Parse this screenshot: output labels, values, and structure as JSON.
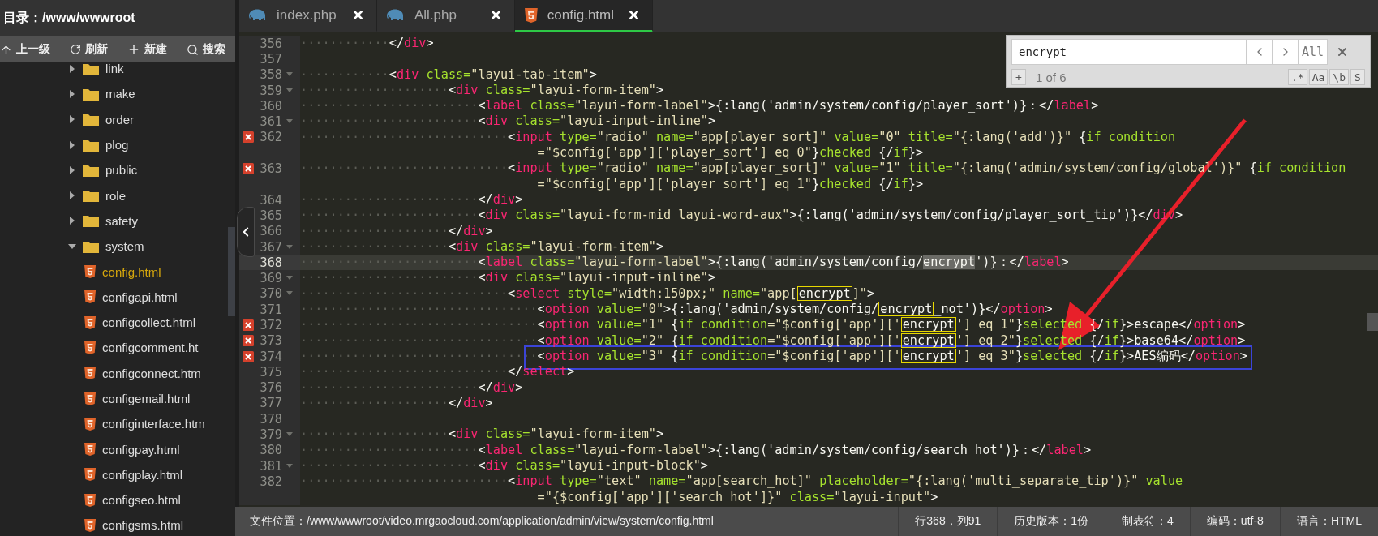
{
  "sidebar": {
    "title": "目录：/www/wwwroot",
    "toolbar": [
      {
        "kind": "up",
        "label": "上一级"
      },
      {
        "kind": "refresh",
        "label": "刷新"
      },
      {
        "kind": "new",
        "label": "新建"
      },
      {
        "kind": "search",
        "label": "搜索"
      }
    ],
    "tree": [
      {
        "label": "link",
        "kind": "folder",
        "expanded": false,
        "selected": false
      },
      {
        "label": "make",
        "kind": "folder",
        "expanded": false,
        "selected": false
      },
      {
        "label": "order",
        "kind": "folder",
        "expanded": false,
        "selected": false
      },
      {
        "label": "plog",
        "kind": "folder",
        "expanded": false,
        "selected": false
      },
      {
        "label": "public",
        "kind": "folder",
        "expanded": false,
        "selected": false
      },
      {
        "label": "role",
        "kind": "folder",
        "expanded": false,
        "selected": false
      },
      {
        "label": "safety",
        "kind": "folder",
        "expanded": false,
        "selected": false
      },
      {
        "label": "system",
        "kind": "folder",
        "expanded": true,
        "selected": false,
        "children": [
          {
            "label": "config.html",
            "kind": "html",
            "selected": true
          },
          {
            "label": "configapi.html",
            "kind": "html",
            "selected": false
          },
          {
            "label": "configcollect.html",
            "kind": "html",
            "selected": false
          },
          {
            "label": "configcomment.ht",
            "kind": "html",
            "selected": false
          },
          {
            "label": "configconnect.htm",
            "kind": "html",
            "selected": false
          },
          {
            "label": "configemail.html",
            "kind": "html",
            "selected": false
          },
          {
            "label": "configinterface.htm",
            "kind": "html",
            "selected": false
          },
          {
            "label": "configpay.html",
            "kind": "html",
            "selected": false
          },
          {
            "label": "configplay.html",
            "kind": "html",
            "selected": false
          },
          {
            "label": "configseo.html",
            "kind": "html",
            "selected": false
          },
          {
            "label": "configsms.html",
            "kind": "html",
            "selected": false
          }
        ]
      }
    ]
  },
  "tabs": [
    {
      "label": "index.php",
      "kind": "php",
      "selected": false
    },
    {
      "label": "All.php",
      "kind": "php",
      "selected": false
    },
    {
      "label": "config.html",
      "kind": "html",
      "selected": true
    }
  ],
  "find": {
    "query": "encrypt",
    "all_label": "All",
    "add_label": "+",
    "count": "1 of 6",
    "options": [
      ".*",
      "Aa",
      "\\b",
      "S"
    ]
  },
  "lines": [
    {
      "n": "356",
      "fold": false,
      "error": false,
      "current": false,
      "boxed": false,
      "tokens": [
        {
          "kind": "ws",
          "text": "············"
        },
        {
          "kind": "plain",
          "text": "</"
        },
        {
          "kind": "tag",
          "text": "div"
        },
        {
          "kind": "plain",
          "text": ">"
        }
      ]
    },
    {
      "n": "357",
      "fold": false,
      "error": false,
      "current": false,
      "boxed": false
    },
    {
      "n": "358",
      "fold": true,
      "error": false,
      "current": false,
      "boxed": false,
      "tokens": [
        {
          "kind": "ws",
          "text": "············"
        },
        {
          "kind": "plain",
          "text": "<"
        },
        {
          "kind": "tag",
          "text": "div"
        },
        {
          "kind": "attr",
          "text": " class="
        },
        {
          "kind": "string",
          "text": "\"layui-tab-item\""
        },
        {
          "kind": "plain",
          "text": ">"
        }
      ]
    },
    {
      "n": "359",
      "fold": true,
      "error": false,
      "current": false,
      "boxed": false,
      "tokens": [
        {
          "kind": "ws",
          "text": "····················"
        },
        {
          "kind": "plain",
          "text": "<"
        },
        {
          "kind": "tag",
          "text": "div"
        },
        {
          "kind": "attr",
          "text": " class="
        },
        {
          "kind": "string",
          "text": "\"layui-form-item\""
        },
        {
          "kind": "plain",
          "text": ">"
        }
      ]
    },
    {
      "n": "360",
      "fold": false,
      "error": false,
      "current": false,
      "boxed": false,
      "tokens": [
        {
          "kind": "ws",
          "text": "························"
        },
        {
          "kind": "plain",
          "text": "<"
        },
        {
          "kind": "tag",
          "text": "label"
        },
        {
          "kind": "attr",
          "text": " class="
        },
        {
          "kind": "string",
          "text": "\"layui-form-label\""
        },
        {
          "kind": "plain",
          "text": ">{:lang('admin/system/config/player_sort')}：</"
        },
        {
          "kind": "tag",
          "text": "label"
        },
        {
          "kind": "plain",
          "text": ">"
        }
      ]
    },
    {
      "n": "361",
      "fold": true,
      "error": false,
      "current": false,
      "boxed": false,
      "tokens": [
        {
          "kind": "ws",
          "text": "························"
        },
        {
          "kind": "plain",
          "text": "<"
        },
        {
          "kind": "tag",
          "text": "div"
        },
        {
          "kind": "attr",
          "text": " class="
        },
        {
          "kind": "string",
          "text": "\"layui-input-inline\""
        },
        {
          "kind": "plain",
          "text": ">"
        }
      ]
    },
    {
      "n": "362",
      "fold": false,
      "error": true,
      "current": false,
      "boxed": false,
      "tokens": [
        {
          "kind": "ws",
          "text": "····························"
        },
        {
          "kind": "plain",
          "text": "<"
        },
        {
          "kind": "tag",
          "text": "input"
        },
        {
          "kind": "attr",
          "text": " type="
        },
        {
          "kind": "string",
          "text": "\"radio\""
        },
        {
          "kind": "attr",
          "text": " name="
        },
        {
          "kind": "string",
          "text": "\"app[player_sort]\""
        },
        {
          "kind": "attr",
          "text": " value="
        },
        {
          "kind": "string",
          "text": "\"0\""
        },
        {
          "kind": "attr",
          "text": " title="
        },
        {
          "kind": "string",
          "text": "\"{:lang('add')}\""
        },
        {
          "kind": "plain",
          "text": " {"
        },
        {
          "kind": "attr",
          "text": "if condition"
        }
      ],
      "wrap_tokens": [
        {
          "kind": "string",
          "text": "=\"$config['app']['player_sort'] eq 0\""
        },
        {
          "kind": "plain",
          "text": "}"
        },
        {
          "kind": "attr",
          "text": "checked"
        },
        {
          "kind": "plain",
          "text": " {/"
        },
        {
          "kind": "attr",
          "text": "if"
        },
        {
          "kind": "plain",
          "text": "}>"
        }
      ]
    },
    {
      "n": "363",
      "fold": false,
      "error": true,
      "current": false,
      "boxed": false,
      "tokens": [
        {
          "kind": "ws",
          "text": "····························"
        },
        {
          "kind": "plain",
          "text": "<"
        },
        {
          "kind": "tag",
          "text": "input"
        },
        {
          "kind": "attr",
          "text": " type="
        },
        {
          "kind": "string",
          "text": "\"radio\""
        },
        {
          "kind": "attr",
          "text": " name="
        },
        {
          "kind": "string",
          "text": "\"app[player_sort]\""
        },
        {
          "kind": "attr",
          "text": " value="
        },
        {
          "kind": "string",
          "text": "\"1\""
        },
        {
          "kind": "attr",
          "text": " title="
        },
        {
          "kind": "string",
          "text": "\"{:lang('admin/system/config/global')}\""
        },
        {
          "kind": "plain",
          "text": " {"
        },
        {
          "kind": "attr",
          "text": "if condition"
        }
      ],
      "wrap_tokens": [
        {
          "kind": "string",
          "text": "=\"$config['app']['player_sort'] eq 1\""
        },
        {
          "kind": "plain",
          "text": "}"
        },
        {
          "kind": "attr",
          "text": "checked"
        },
        {
          "kind": "plain",
          "text": " {/"
        },
        {
          "kind": "attr",
          "text": "if"
        },
        {
          "kind": "plain",
          "text": "}>"
        }
      ]
    },
    {
      "n": "364",
      "fold": false,
      "error": false,
      "current": false,
      "boxed": false,
      "tokens": [
        {
          "kind": "ws",
          "text": "························"
        },
        {
          "kind": "plain",
          "text": "</"
        },
        {
          "kind": "tag",
          "text": "div"
        },
        {
          "kind": "plain",
          "text": ">"
        }
      ]
    },
    {
      "n": "365",
      "fold": false,
      "error": false,
      "current": false,
      "boxed": false,
      "tokens": [
        {
          "kind": "ws",
          "text": "························"
        },
        {
          "kind": "plain",
          "text": "<"
        },
        {
          "kind": "tag",
          "text": "div"
        },
        {
          "kind": "attr",
          "text": " class="
        },
        {
          "kind": "string",
          "text": "\"layui-form-mid layui-word-aux\""
        },
        {
          "kind": "plain",
          "text": ">{:lang('admin/system/config/player_sort_tip')}</"
        },
        {
          "kind": "tag",
          "text": "div"
        },
        {
          "kind": "plain",
          "text": ">"
        }
      ]
    },
    {
      "n": "366",
      "fold": false,
      "error": false,
      "current": false,
      "boxed": false,
      "tokens": [
        {
          "kind": "ws",
          "text": "····················"
        },
        {
          "kind": "plain",
          "text": "</"
        },
        {
          "kind": "tag",
          "text": "div"
        },
        {
          "kind": "plain",
          "text": ">"
        }
      ]
    },
    {
      "n": "367",
      "fold": true,
      "error": false,
      "current": false,
      "boxed": false,
      "tokens": [
        {
          "kind": "ws",
          "text": "····················"
        },
        {
          "kind": "plain",
          "text": "<"
        },
        {
          "kind": "tag",
          "text": "div"
        },
        {
          "kind": "attr",
          "text": " class="
        },
        {
          "kind": "string",
          "text": "\"layui-form-item\""
        },
        {
          "kind": "plain",
          "text": ">"
        }
      ]
    },
    {
      "n": "368",
      "fold": false,
      "error": false,
      "current": true,
      "boxed": false,
      "tokens": [
        {
          "kind": "ws",
          "text": "························"
        },
        {
          "kind": "plain",
          "text": "<"
        },
        {
          "kind": "tag",
          "text": "label"
        },
        {
          "kind": "attr",
          "text": " class="
        },
        {
          "kind": "string",
          "text": "\"layui-form-label\""
        },
        {
          "kind": "plain",
          "text": ">{:lang('admin/system/config/"
        },
        {
          "kind": "current",
          "text": "encrypt"
        },
        {
          "kind": "plain",
          "text": "')}：</"
        },
        {
          "kind": "tag",
          "text": "label"
        },
        {
          "kind": "plain",
          "text": ">"
        }
      ]
    },
    {
      "n": "369",
      "fold": true,
      "error": false,
      "current": false,
      "boxed": false,
      "tokens": [
        {
          "kind": "ws",
          "text": "························"
        },
        {
          "kind": "plain",
          "text": "<"
        },
        {
          "kind": "tag",
          "text": "div"
        },
        {
          "kind": "attr",
          "text": " class="
        },
        {
          "kind": "string",
          "text": "\"layui-input-inline\""
        },
        {
          "kind": "plain",
          "text": ">"
        }
      ]
    },
    {
      "n": "370",
      "fold": true,
      "error": false,
      "current": false,
      "boxed": false,
      "tokens": [
        {
          "kind": "ws",
          "text": "····························"
        },
        {
          "kind": "plain",
          "text": "<"
        },
        {
          "kind": "tag",
          "text": "select"
        },
        {
          "kind": "attr",
          "text": " style="
        },
        {
          "kind": "string",
          "text": "\"width:150px;\""
        },
        {
          "kind": "attr",
          "text": " name="
        },
        {
          "kind": "string",
          "text": "\"app["
        },
        {
          "kind": "match",
          "text": "encrypt"
        },
        {
          "kind": "string",
          "text": "]\""
        },
        {
          "kind": "plain",
          "text": ">"
        }
      ]
    },
    {
      "n": "371",
      "fold": false,
      "error": false,
      "current": false,
      "boxed": false,
      "tokens": [
        {
          "kind": "ws",
          "text": "································"
        },
        {
          "kind": "plain",
          "text": "<"
        },
        {
          "kind": "tag",
          "text": "option"
        },
        {
          "kind": "attr",
          "text": " value="
        },
        {
          "kind": "string",
          "text": "\"0\""
        },
        {
          "kind": "plain",
          "text": ">{:lang('admin/system/config/"
        },
        {
          "kind": "match",
          "text": "encrypt"
        },
        {
          "kind": "plain",
          "text": "_not')}</"
        },
        {
          "kind": "tag",
          "text": "option"
        },
        {
          "kind": "plain",
          "text": ">"
        }
      ]
    },
    {
      "n": "372",
      "fold": false,
      "error": true,
      "current": false,
      "boxed": false,
      "tokens": [
        {
          "kind": "ws",
          "text": "································"
        },
        {
          "kind": "plain",
          "text": "<"
        },
        {
          "kind": "tag",
          "text": "option"
        },
        {
          "kind": "attr",
          "text": " value="
        },
        {
          "kind": "string",
          "text": "\"1\""
        },
        {
          "kind": "plain",
          "text": " {"
        },
        {
          "kind": "attr",
          "text": "if condition"
        },
        {
          "kind": "string",
          "text": "=\"$config['app']['"
        },
        {
          "kind": "match",
          "text": "encrypt"
        },
        {
          "kind": "string",
          "text": "'] eq 1\""
        },
        {
          "kind": "plain",
          "text": "}"
        },
        {
          "kind": "attr",
          "text": "selected"
        },
        {
          "kind": "plain",
          "text": " {/"
        },
        {
          "kind": "attr",
          "text": "if"
        },
        {
          "kind": "plain",
          "text": "}>escape</"
        },
        {
          "kind": "tag",
          "text": "option"
        },
        {
          "kind": "plain",
          "text": ">"
        }
      ]
    },
    {
      "n": "373",
      "fold": false,
      "error": true,
      "current": false,
      "boxed": false,
      "tokens": [
        {
          "kind": "ws",
          "text": "································"
        },
        {
          "kind": "plain",
          "text": "<"
        },
        {
          "kind": "tag",
          "text": "option"
        },
        {
          "kind": "attr",
          "text": " value="
        },
        {
          "kind": "string",
          "text": "\"2\""
        },
        {
          "kind": "plain",
          "text": " {"
        },
        {
          "kind": "attr",
          "text": "if condition"
        },
        {
          "kind": "string",
          "text": "=\"$config['app']['"
        },
        {
          "kind": "match",
          "text": "encrypt"
        },
        {
          "kind": "string",
          "text": "'] eq 2\""
        },
        {
          "kind": "plain",
          "text": "}"
        },
        {
          "kind": "attr",
          "text": "selected"
        },
        {
          "kind": "plain",
          "text": " {/"
        },
        {
          "kind": "attr",
          "text": "if"
        },
        {
          "kind": "plain",
          "text": "}>base64</"
        },
        {
          "kind": "tag",
          "text": "option"
        },
        {
          "kind": "plain",
          "text": ">"
        }
      ]
    },
    {
      "n": "374",
      "fold": false,
      "error": true,
      "current": false,
      "boxed": true,
      "tokens": [
        {
          "kind": "ws",
          "text": "································"
        },
        {
          "kind": "plain",
          "text": "<"
        },
        {
          "kind": "tag",
          "text": "option"
        },
        {
          "kind": "attr",
          "text": " value="
        },
        {
          "kind": "string",
          "text": "\"3\""
        },
        {
          "kind": "plain",
          "text": " {"
        },
        {
          "kind": "attr",
          "text": "if condition"
        },
        {
          "kind": "string",
          "text": "=\"$config['app']['"
        },
        {
          "kind": "match",
          "text": "encrypt"
        },
        {
          "kind": "string",
          "text": "'] eq 3\""
        },
        {
          "kind": "plain",
          "text": "}"
        },
        {
          "kind": "attr",
          "text": "selected"
        },
        {
          "kind": "plain",
          "text": " {/"
        },
        {
          "kind": "attr",
          "text": "if"
        },
        {
          "kind": "plain",
          "text": "}>AES编码</"
        },
        {
          "kind": "tag",
          "text": "option"
        },
        {
          "kind": "plain",
          "text": ">"
        }
      ]
    },
    {
      "n": "375",
      "fold": false,
      "error": false,
      "current": false,
      "boxed": false,
      "tokens": [
        {
          "kind": "ws",
          "text": "····························"
        },
        {
          "kind": "plain",
          "text": "</"
        },
        {
          "kind": "tag",
          "text": "select"
        },
        {
          "kind": "plain",
          "text": ">"
        }
      ]
    },
    {
      "n": "376",
      "fold": false,
      "error": false,
      "current": false,
      "boxed": false,
      "tokens": [
        {
          "kind": "ws",
          "text": "························"
        },
        {
          "kind": "plain",
          "text": "</"
        },
        {
          "kind": "tag",
          "text": "div"
        },
        {
          "kind": "plain",
          "text": ">"
        }
      ]
    },
    {
      "n": "377",
      "fold": false,
      "error": false,
      "current": false,
      "boxed": false,
      "tokens": [
        {
          "kind": "ws",
          "text": "····················"
        },
        {
          "kind": "plain",
          "text": "</"
        },
        {
          "kind": "tag",
          "text": "div"
        },
        {
          "kind": "plain",
          "text": ">"
        }
      ]
    },
    {
      "n": "378",
      "fold": false,
      "error": false,
      "current": false,
      "boxed": false
    },
    {
      "n": "379",
      "fold": true,
      "error": false,
      "current": false,
      "boxed": false,
      "tokens": [
        {
          "kind": "ws",
          "text": "····················"
        },
        {
          "kind": "plain",
          "text": "<"
        },
        {
          "kind": "tag",
          "text": "div"
        },
        {
          "kind": "attr",
          "text": " class="
        },
        {
          "kind": "string",
          "text": "\"layui-form-item\""
        },
        {
          "kind": "plain",
          "text": ">"
        }
      ]
    },
    {
      "n": "380",
      "fold": false,
      "error": false,
      "current": false,
      "boxed": false,
      "tokens": [
        {
          "kind": "ws",
          "text": "························"
        },
        {
          "kind": "plain",
          "text": "<"
        },
        {
          "kind": "tag",
          "text": "label"
        },
        {
          "kind": "attr",
          "text": " class="
        },
        {
          "kind": "string",
          "text": "\"layui-form-label\""
        },
        {
          "kind": "plain",
          "text": ">{:lang('admin/system/config/search_hot')}：</"
        },
        {
          "kind": "tag",
          "text": "label"
        },
        {
          "kind": "plain",
          "text": ">"
        }
      ]
    },
    {
      "n": "381",
      "fold": true,
      "error": false,
      "current": false,
      "boxed": false,
      "tokens": [
        {
          "kind": "ws",
          "text": "························"
        },
        {
          "kind": "plain",
          "text": "<"
        },
        {
          "kind": "tag",
          "text": "div"
        },
        {
          "kind": "attr",
          "text": " class="
        },
        {
          "kind": "string",
          "text": "\"layui-input-block\""
        },
        {
          "kind": "plain",
          "text": ">"
        }
      ]
    },
    {
      "n": "382",
      "fold": false,
      "error": false,
      "current": false,
      "boxed": false,
      "tokens": [
        {
          "kind": "ws",
          "text": "····························"
        },
        {
          "kind": "plain",
          "text": "<"
        },
        {
          "kind": "tag",
          "text": "input"
        },
        {
          "kind": "attr",
          "text": " type="
        },
        {
          "kind": "string",
          "text": "\"text\""
        },
        {
          "kind": "attr",
          "text": " name="
        },
        {
          "kind": "string",
          "text": "\"app[search_hot]\""
        },
        {
          "kind": "attr",
          "text": " placeholder="
        },
        {
          "kind": "string",
          "text": "\"{:lang('multi_separate_tip')}\""
        },
        {
          "kind": "attr",
          "text": " value"
        }
      ],
      "wrap_tokens": [
        {
          "kind": "string",
          "text": "=\"{$config['app']['search_hot']}\""
        },
        {
          "kind": "attr",
          "text": " class="
        },
        {
          "kind": "string",
          "text": "\"layui-input\""
        },
        {
          "kind": "plain",
          "text": ">"
        }
      ]
    }
  ],
  "status_bar": {
    "path": "文件位置：/www/wwwroot/video.mrgaocloud.com/application/admin/view/system/config.html",
    "items": [
      "行368，列91",
      "历史版本：1份",
      "制表符：4",
      "编码：utf-8",
      "语言：HTML"
    ]
  }
}
